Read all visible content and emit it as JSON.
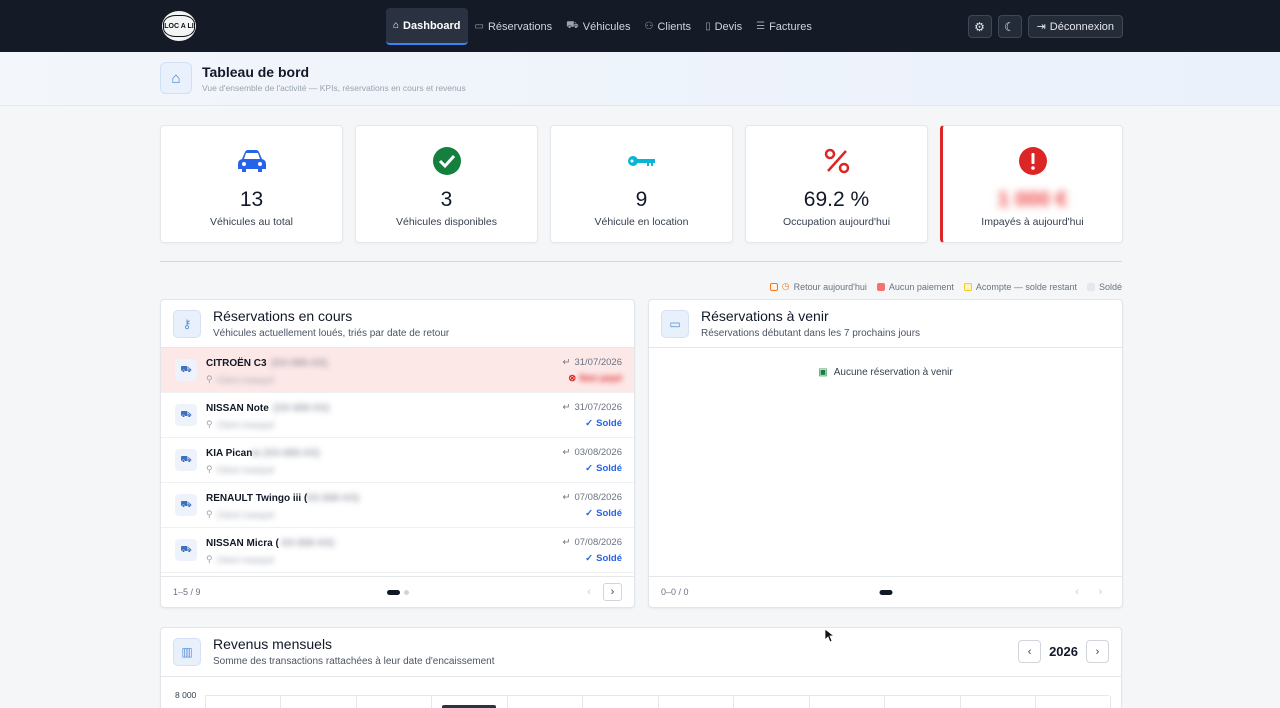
{
  "nav": {
    "logo_text": "LOC A LI",
    "items": [
      {
        "label": "Dashboard",
        "icon": "home-icon"
      },
      {
        "label": "Réservations",
        "icon": "calendar-icon"
      },
      {
        "label": "Véhicules",
        "icon": "car-icon"
      },
      {
        "label": "Clients",
        "icon": "users-icon"
      },
      {
        "label": "Devis",
        "icon": "document-icon"
      },
      {
        "label": "Factures",
        "icon": "invoice-icon"
      }
    ],
    "logout_label": "Déconnexion"
  },
  "header": {
    "title": "Tableau de bord",
    "subtitle": "Vue d'ensemble de l'activité — KPIs, réservations en cours et revenus"
  },
  "kpis": [
    {
      "value": "13",
      "label": "Véhicules au total",
      "icon": "car-icon",
      "color": "#2563eb"
    },
    {
      "value": "3",
      "label": "Véhicules disponibles",
      "icon": "check-circle-icon",
      "color": "#15803d"
    },
    {
      "value": "9",
      "label": "Véhicule en location",
      "icon": "key-icon",
      "color": "#06b6d4"
    },
    {
      "value": "69.2 %",
      "label": "Occupation aujourd'hui",
      "icon": "percent-icon",
      "color": "#dc2626"
    },
    {
      "value": "1 000 €",
      "label": "Impayés à aujourd'hui",
      "icon": "exclamation-circle-icon",
      "color": "#dc2626"
    }
  ],
  "legend": [
    {
      "label": "Retour aujourd'hui",
      "color": "#f97316"
    },
    {
      "label": "Aucun paiement",
      "color": "#f87171"
    },
    {
      "label": "Acompte — solde restant",
      "color": "#facc15"
    },
    {
      "label": "Soldé",
      "color": "#e5e7eb"
    }
  ],
  "current": {
    "title": "Réservations en cours",
    "subtitle": "Véhicules actuellement loués, triés par date de retour",
    "rows": [
      {
        "vehicle": "CITROËN C3",
        "plate": "(XX-000-XX)",
        "client": "Client masqué",
        "date": "31/07/2026",
        "status": "Non payé"
      },
      {
        "vehicle": "NISSAN Note",
        "plate": "(XX-000-XX)",
        "client": "Client masqué",
        "date": "31/07/2026",
        "status": "Soldé"
      },
      {
        "vehicle": "KIA Pican",
        "plate": "to (XX-000-XX)",
        "client": "Client masqué",
        "date": "03/08/2026",
        "status": "Soldé"
      },
      {
        "vehicle": "RENAULT Twingo iii (",
        "plate": "XX-000-XX)",
        "client": "Client masqué",
        "date": "07/08/2026",
        "status": "Soldé"
      },
      {
        "vehicle": "NISSAN Micra (",
        "plate": "XX-000-XX)",
        "client": "Client masqué",
        "date": "07/08/2026",
        "status": "Soldé"
      }
    ],
    "pager": "1–5 / 9"
  },
  "upcoming": {
    "title": "Réservations à venir",
    "subtitle": "Réservations débutant dans les 7 prochains jours",
    "empty": "Aucune réservation à venir",
    "pager": "0–0 / 0"
  },
  "revenue": {
    "title": "Revenus mensuels",
    "subtitle": "Somme des transactions rattachées à leur date d'encaissement",
    "year": "2026",
    "y_tick": "8 000"
  }
}
